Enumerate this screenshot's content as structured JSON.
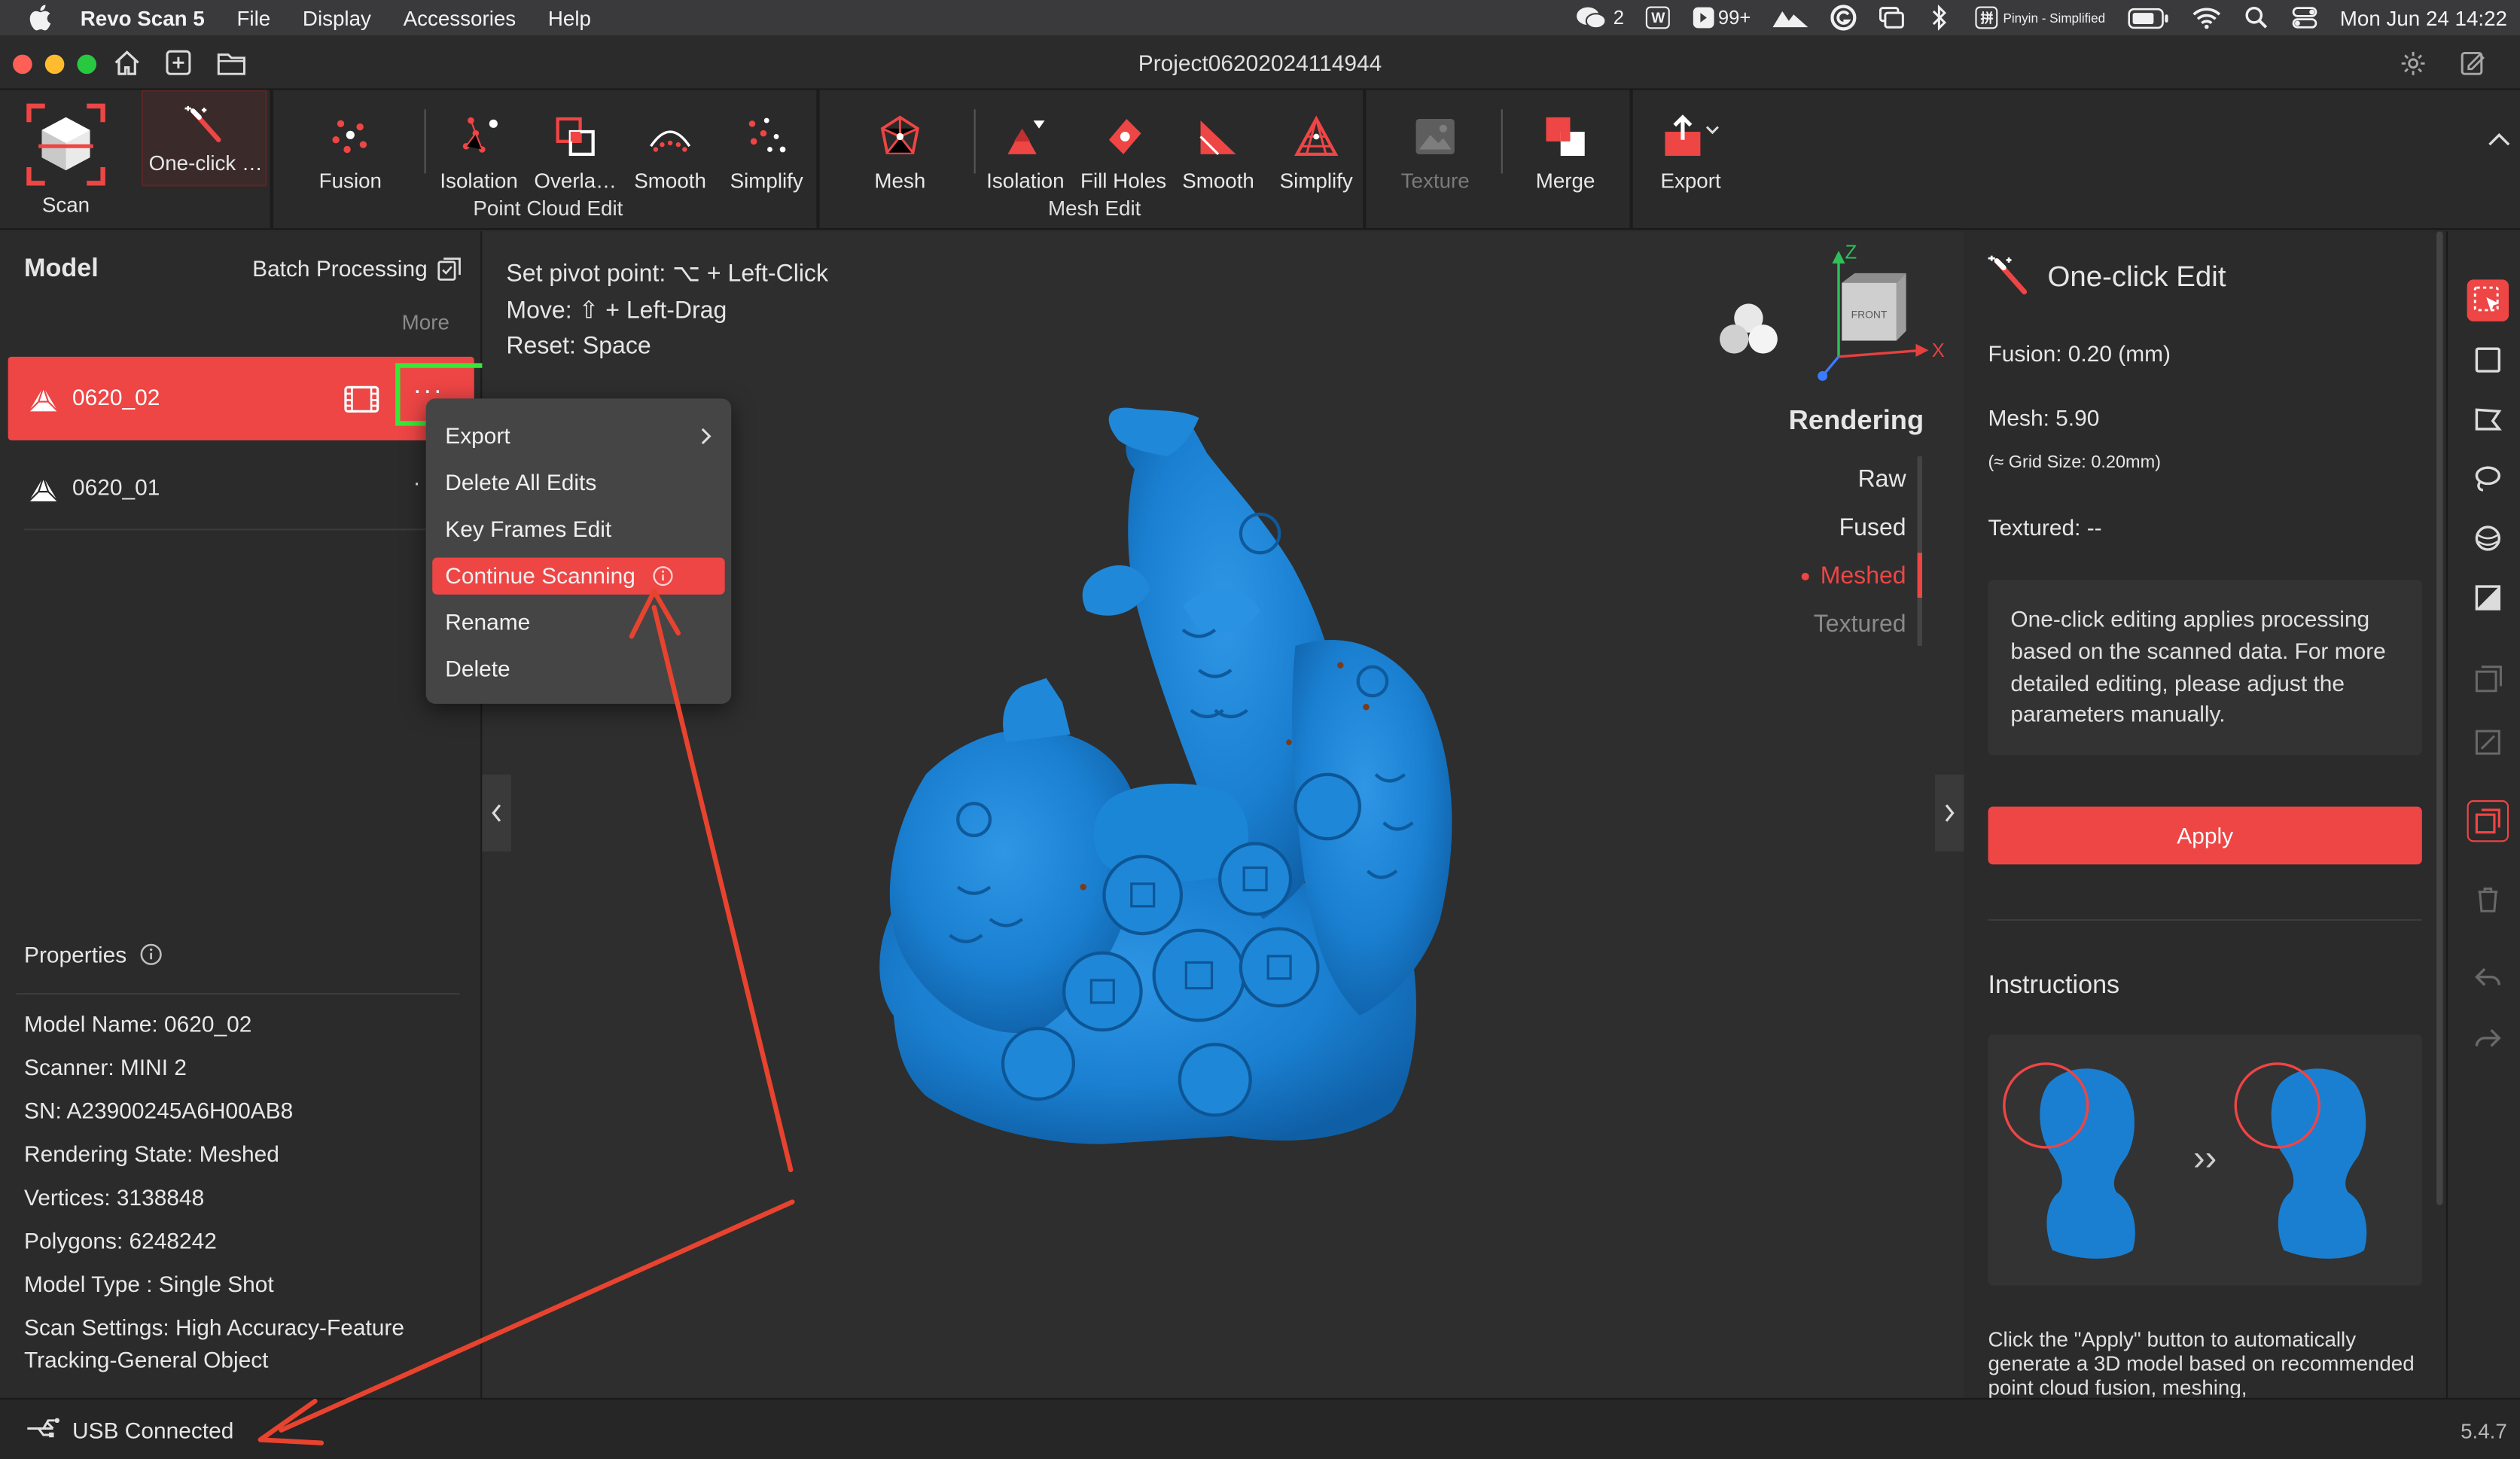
{
  "menubar": {
    "app_name": "Revo Scan 5",
    "menus": [
      "File",
      "Display",
      "Accessories",
      "Help"
    ],
    "wechat_count": "2",
    "notif_count": "99+",
    "input_method": "Pinyin - Simplified",
    "datetime": "Mon Jun 24  14:22"
  },
  "window": {
    "title": "Project06202024114944"
  },
  "toolbar": {
    "scan": "Scan",
    "one_click": "One-click …",
    "fusion": "Fusion",
    "isolation_pc": "Isolation",
    "overlap": "Overla…",
    "smooth_pc": "Smooth",
    "simplify_pc": "Simplify",
    "group_point_cloud": "Point Cloud Edit",
    "mesh": "Mesh",
    "isolation_mesh": "Isolation",
    "fill_holes": "Fill Holes",
    "smooth_mesh": "Smooth",
    "simplify_mesh": "Simplify",
    "group_mesh": "Mesh Edit",
    "texture": "Texture",
    "merge": "Merge",
    "export": "Export"
  },
  "left": {
    "model_title": "Model",
    "batch_processing": "Batch Processing",
    "more": "More",
    "models": [
      {
        "name": "0620_02",
        "dots": "···"
      },
      {
        "name": "0620_01",
        "dots": "·"
      }
    ],
    "properties_title": "Properties",
    "properties": [
      "Model Name:  0620_02",
      "Scanner:  MINI 2",
      "SN:  A23900245A6H00AB8",
      "Rendering State:  Meshed",
      "Vertices:  3138848",
      "Polygons:  6248242",
      "Model Type :  Single Shot",
      "Scan Settings:  High Accuracy-Feature",
      "Tracking-General Object"
    ]
  },
  "context_menu": {
    "items": [
      "Export",
      "Delete All Edits",
      "Key Frames Edit",
      "Continue Scanning",
      "Rename",
      "Delete"
    ],
    "highlighted": "Continue Scanning"
  },
  "viewport": {
    "hint1_label": "Set pivot point:",
    "hint1_value": "⌥ + Left-Click",
    "hint2_label": "Move:",
    "hint2_value": "⇧ + Left-Drag",
    "hint3_label": "Reset:",
    "hint3_value": "Space",
    "axis_z": "Z",
    "axis_x": "X",
    "cube_face": "FRONT",
    "rendering_title": "Rendering",
    "rendering_options": [
      "Raw",
      "Fused",
      "Meshed",
      "Textured"
    ],
    "rendering_active": "Meshed"
  },
  "right": {
    "title": "One-click Edit",
    "fusion": "Fusion:   0.20 (mm)",
    "mesh": "Mesh:   5.90",
    "grid_size": "(≈ Grid Size: 0.20mm)",
    "textured": "Textured: --",
    "info": "One-click editing applies processing based on the scanned data. For more detailed editing, please adjust the parameters manually.",
    "apply": "Apply",
    "instructions_title": "Instructions",
    "instructions_text": "Click the \"Apply\" button to automatically generate a 3D model based on recommended point cloud fusion, meshing,"
  },
  "status": {
    "usb": "USB Connected",
    "version": "5.4.7"
  },
  "colors": {
    "accent": "#ee4545",
    "model_blue": "#1a7fd0",
    "annotation_green": "#39e639"
  }
}
